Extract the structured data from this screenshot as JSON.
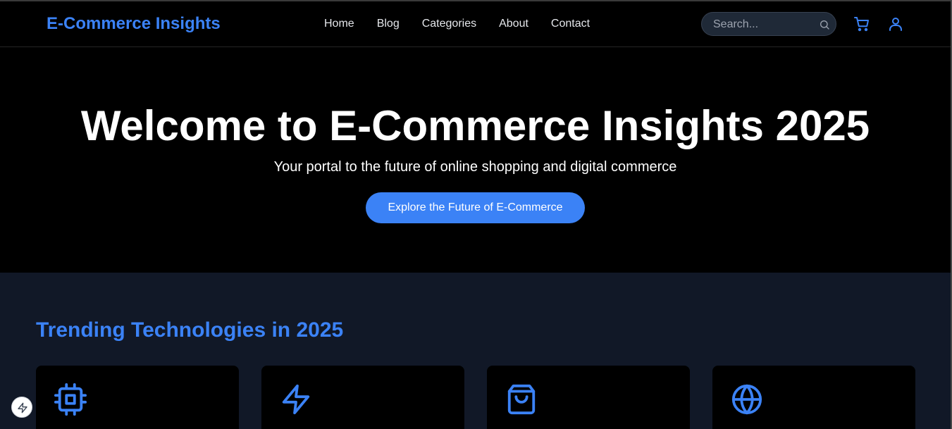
{
  "header": {
    "brand": "E-Commerce Insights",
    "nav": [
      "Home",
      "Blog",
      "Categories",
      "About",
      "Contact"
    ],
    "search_placeholder": "Search..."
  },
  "hero": {
    "title": "Welcome to E-Commerce Insights 2025",
    "subtitle": "Your portal to the future of online shopping and digital commerce",
    "cta_label": "Explore the Future of E-Commerce"
  },
  "trending": {
    "heading": "Trending Technologies in 2025",
    "cards": [
      {
        "icon": "cpu-icon"
      },
      {
        "icon": "lightning-icon"
      },
      {
        "icon": "shopping-bag-icon"
      },
      {
        "icon": "globe-icon"
      }
    ]
  },
  "colors": {
    "accent": "#3b82f6",
    "section_bg": "#111827",
    "page_bg": "#000000"
  }
}
